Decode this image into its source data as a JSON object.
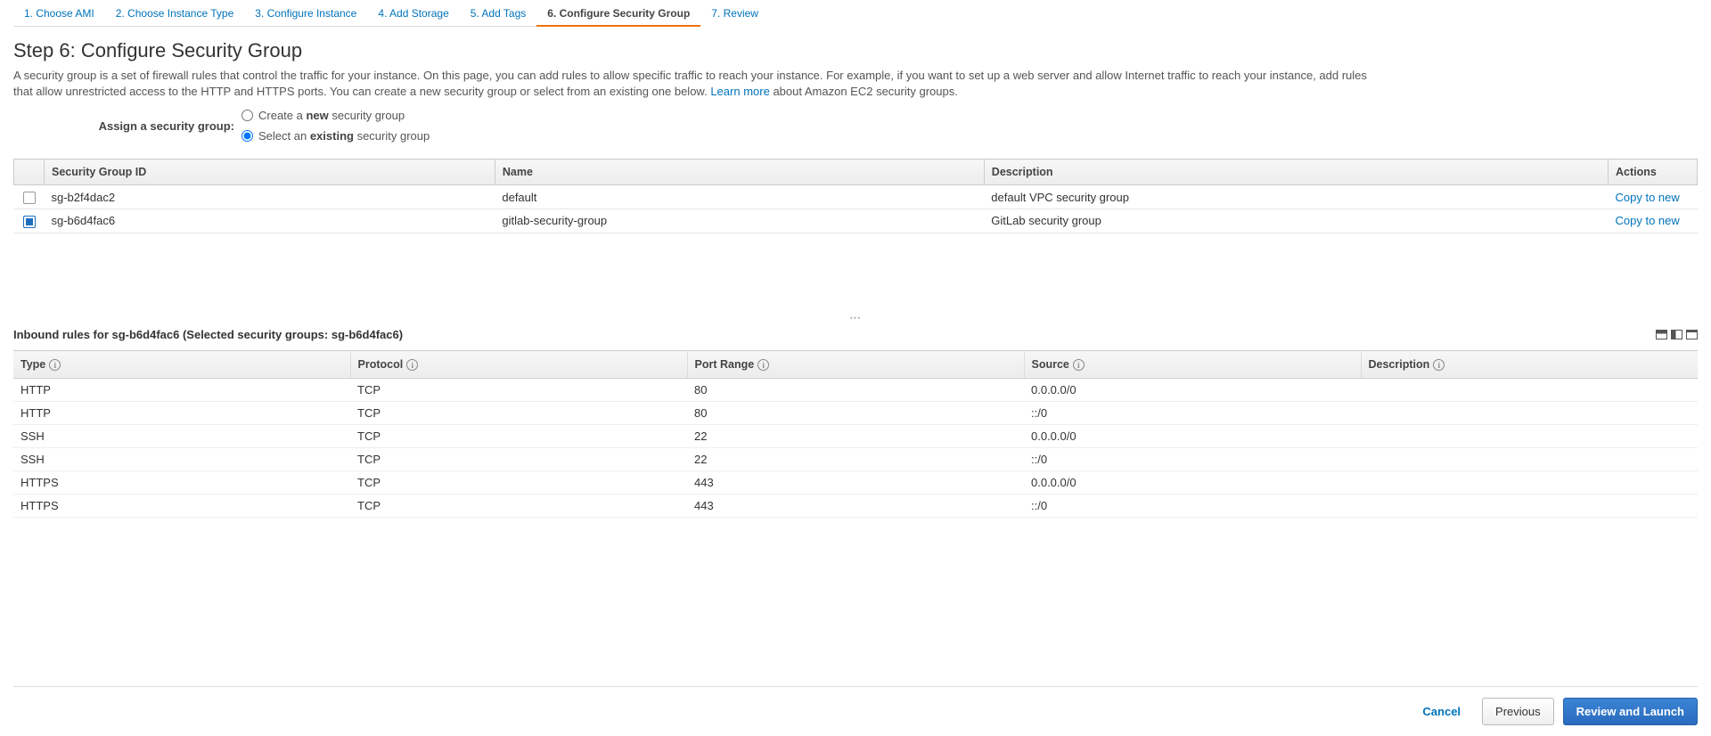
{
  "wizard": {
    "tabs": [
      "1. Choose AMI",
      "2. Choose Instance Type",
      "3. Configure Instance",
      "4. Add Storage",
      "5. Add Tags",
      "6. Configure Security Group",
      "7. Review"
    ],
    "active_index": 5
  },
  "page": {
    "title": "Step 6: Configure Security Group",
    "description_before": "A security group is a set of firewall rules that control the traffic for your instance. On this page, you can add rules to allow specific traffic to reach your instance. For example, if you want to set up a web server and allow Internet traffic to reach your instance, add rules that allow unrestricted access to the HTTP and HTTPS ports. You can create a new security group or select from an existing one below. ",
    "learn_more": "Learn more",
    "description_after": " about Amazon EC2 security groups."
  },
  "assign": {
    "label": "Assign a security group:",
    "option_new_before": "Create a ",
    "option_new_bold": "new",
    "option_new_after": " security group",
    "option_existing_before": "Select an ",
    "option_existing_bold": "existing",
    "option_existing_after": " security group",
    "selected": "existing"
  },
  "sg_table": {
    "headers": {
      "id": "Security Group ID",
      "name": "Name",
      "description": "Description",
      "actions": "Actions"
    },
    "copy_label": "Copy to new",
    "rows": [
      {
        "checked": false,
        "id": "sg-b2f4dac2",
        "name": "default",
        "description": "default VPC security group"
      },
      {
        "checked": true,
        "id": "sg-b6d4fac6",
        "name": "gitlab-security-group",
        "description": "GitLab security group"
      }
    ]
  },
  "inbound": {
    "title": "Inbound rules for sg-b6d4fac6 (Selected security groups: sg-b6d4fac6)",
    "headers": {
      "type": "Type",
      "protocol": "Protocol",
      "port": "Port Range",
      "source": "Source",
      "description": "Description"
    },
    "rows": [
      {
        "type": "HTTP",
        "protocol": "TCP",
        "port": "80",
        "source": "0.0.0.0/0",
        "description": ""
      },
      {
        "type": "HTTP",
        "protocol": "TCP",
        "port": "80",
        "source": "::/0",
        "description": ""
      },
      {
        "type": "SSH",
        "protocol": "TCP",
        "port": "22",
        "source": "0.0.0.0/0",
        "description": ""
      },
      {
        "type": "SSH",
        "protocol": "TCP",
        "port": "22",
        "source": "::/0",
        "description": ""
      },
      {
        "type": "HTTPS",
        "protocol": "TCP",
        "port": "443",
        "source": "0.0.0.0/0",
        "description": ""
      },
      {
        "type": "HTTPS",
        "protocol": "TCP",
        "port": "443",
        "source": "::/0",
        "description": ""
      }
    ]
  },
  "footer": {
    "cancel": "Cancel",
    "previous": "Previous",
    "review": "Review and Launch"
  }
}
